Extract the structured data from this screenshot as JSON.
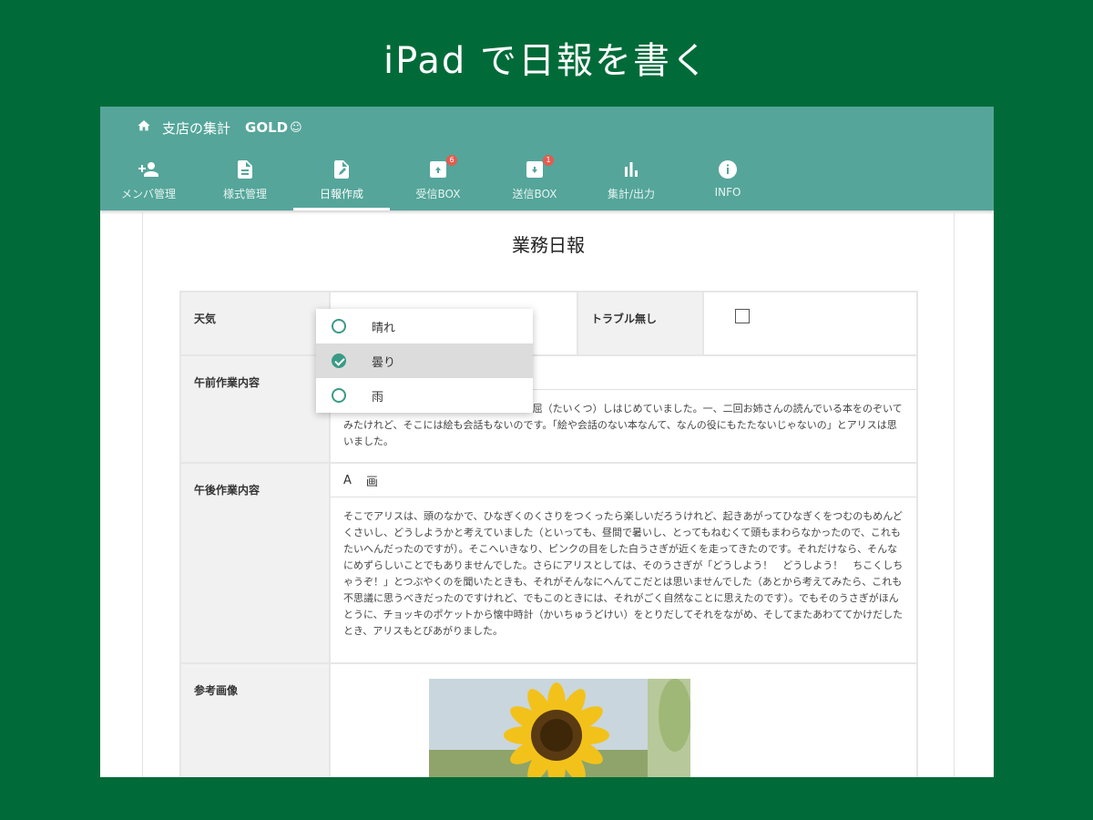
{
  "promo": {
    "title": "iPad で日報を書く"
  },
  "breadcrumb": {
    "branch": "支店の集計",
    "plan": "GOLD",
    "plan_icon": "☺"
  },
  "nav": [
    {
      "label": "メンバ管理",
      "icon": "person-add-icon",
      "badge": ""
    },
    {
      "label": "様式管理",
      "icon": "document-icon",
      "badge": ""
    },
    {
      "label": "日報作成",
      "icon": "file-edit-icon",
      "badge": "",
      "active": true
    },
    {
      "label": "受信BOX",
      "icon": "inbox-icon",
      "badge": "6"
    },
    {
      "label": "送信BOX",
      "icon": "outbox-icon",
      "badge": "1"
    },
    {
      "label": "集計/出力",
      "icon": "bar-chart-icon",
      "badge": ""
    },
    {
      "label": "INFO",
      "icon": "info-icon",
      "badge": ""
    }
  ],
  "sheet": {
    "title": "業務日報"
  },
  "form": {
    "weather_label": "天気",
    "trouble_label": "トラブル無し",
    "morning_label": "午前作業内容",
    "morning_text": "て、なんにもすることがないのでとても退屈（たいくつ）しはじめていました。一、二回お姉さんの読んでいる本をのぞいてみたけれど、そこには絵も会話もないのです。「絵や会話のない本なんて、なんの役にもたたないじゃないの」とアリスは思いました。",
    "afternoon_label": "午後作業内容",
    "toolbar_a": "A",
    "toolbar_b": "画",
    "afternoon_text": "そこでアリスは、頭のなかで、ひなぎくのくさりをつくったら楽しいだろうけれど、起きあがってひなぎくをつむのもめんどくさいし、どうしようかと考えていました（といっても、昼間で暑いし、とってもねむくて頭もまわらなかったので、これもたいへんだったのですが）。そこへいきなり、ピンクの目をした白うさぎが近くを走ってきたのです。それだけなら、そんなにめずらしいことでもありませんでした。さらにアリスとしては、そのうさぎが「どうしよう！　どうしよう！　ちこくしちゃうぞ！」とつぶやくのを聞いたときも、それがそんなにへんてこだとは思いませんでした（あとから考えてみたら、これも不思議に思うべきだったのですけれど、でもこのときには、それがごく自然なことに思えたのです）。でもそのうさぎがほんとうに、チョッキのポケットから懐中時計（かいちゅうどけい）をとりだしてそれをながめ、そしてまたあわててかけだしたとき、アリスもとびあがりました。",
    "image_label": "参考画像"
  },
  "dropdown": {
    "options": [
      "晴れ",
      "曇り",
      "雨"
    ],
    "selected_index": 1
  },
  "colors": {
    "background": "#006b38",
    "appbar": "#55a59a",
    "accent": "#3a9a85",
    "badge": "#e25c4f"
  }
}
